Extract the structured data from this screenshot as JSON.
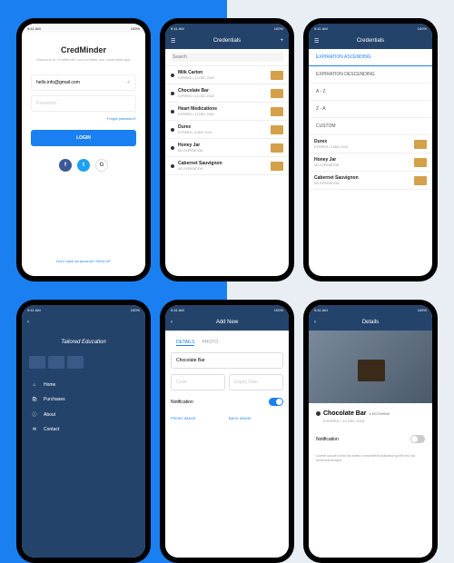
{
  "status": {
    "time": "9:41 AM",
    "battery": "100%"
  },
  "login": {
    "title": "CredMinder",
    "subtitle": "Welcome to CredMinder, your number one credentials app",
    "email": "hello.info@gmail.com",
    "password_ph": "Password",
    "forgot": "Forgot password?",
    "btn": "LOGIN",
    "signup_prompt": "Don't have an account? ",
    "signup_link": "SIGN UP"
  },
  "credentials": {
    "title": "Credentials",
    "search_ph": "Search",
    "items": [
      {
        "name": "Milk Carton",
        "status": "EXPIRED",
        "date": "12 DEC 2018"
      },
      {
        "name": "Chocolate Bar",
        "status": "EXPIRED",
        "date": "12 DEC 2018"
      },
      {
        "name": "Heart Medications",
        "status": "EXPIRED",
        "date": "12 DEC 2018"
      },
      {
        "name": "Durex",
        "status": "EXPIRES",
        "date": "4 MAY 2019"
      },
      {
        "name": "Honey Jar",
        "status": "NO EXPIRATION",
        "date": ""
      },
      {
        "name": "Cabernet Sauvignon",
        "status": "NO EXPIRATION",
        "date": ""
      }
    ]
  },
  "filter": {
    "options": [
      "EXPIRATION ASCENDING",
      "EXPIRATION DESCENDING",
      "A - Z",
      "Z - A",
      "CUSTOM"
    ],
    "list": [
      {
        "name": "Durex",
        "status": "EXPIRES",
        "date": "4 MAY 2019"
      },
      {
        "name": "Honey Jar",
        "status": "NO EXPIRATION",
        "date": ""
      },
      {
        "name": "Cabernet Sauvignon",
        "status": "NO EXPIRATION",
        "date": ""
      }
    ]
  },
  "nav": {
    "brand": "Tailored Education",
    "items": [
      "Home",
      "Purchases",
      "About",
      "Contact"
    ]
  },
  "addnew": {
    "title": "Add New",
    "tabs": [
      "DETAILS",
      "PHOTO"
    ],
    "name_val": "Chocolate Bar",
    "code_ph": "Code",
    "exp_ph": "Expiry Date",
    "notification": "Notification",
    "front_label": "FRONT IMAGE",
    "back_label": "BACK IMAGE"
  },
  "details": {
    "title": "Details",
    "name": "Chocolate Bar",
    "code": "B173HDW",
    "status": "EXPIRED",
    "date": "12 DEC 2018",
    "notification": "Notification",
    "desc": "Lorem ipsum dolor sit amet consectetur adipisicing elit sed do eiusmod tempor"
  }
}
